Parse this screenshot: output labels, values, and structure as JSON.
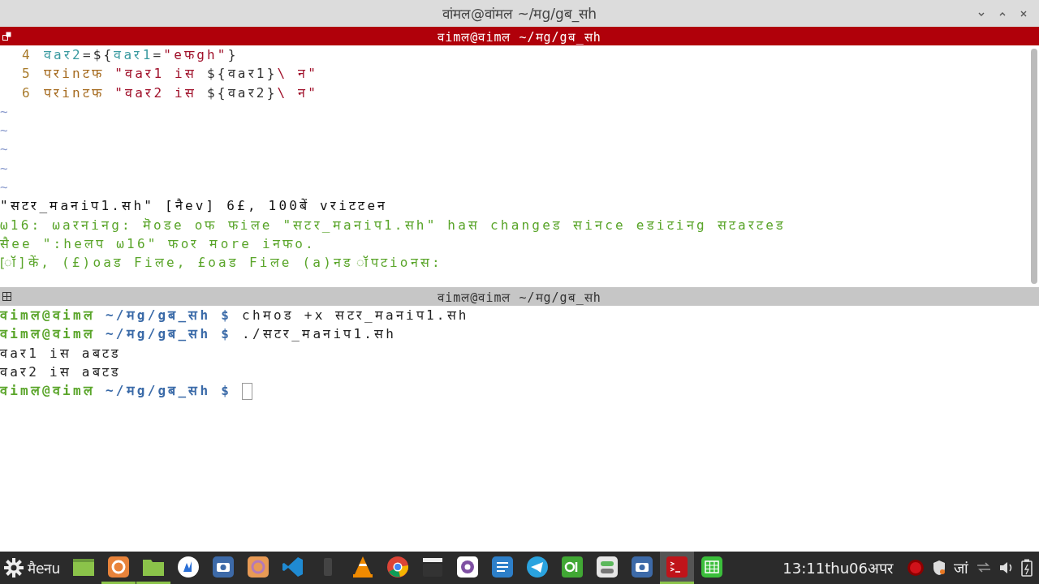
{
  "window": {
    "title": "वांमल@वांमल ~/मg/gब_सh"
  },
  "vim_pane": {
    "title": "वimल@वimल ~/मg/gब_सh",
    "selected": true,
    "lines": [
      {
        "number": "4",
        "segments": [
          {
            "kind": "ident",
            "text": "वaर2"
          },
          {
            "kind": "plain",
            "text": "=${"
          },
          {
            "kind": "ident",
            "text": "वaर1"
          },
          {
            "kind": "plain",
            "text": "="
          },
          {
            "kind": "string",
            "text": "\"eफgh\""
          },
          {
            "kind": "plain",
            "text": "}"
          }
        ]
      },
      {
        "number": "5",
        "segments": [
          {
            "kind": "keyword",
            "text": "परinटफ"
          },
          {
            "kind": "string",
            "text": "\"वaर1 iस "
          },
          {
            "kind": "plain",
            "text": "${वaर1}"
          },
          {
            "kind": "string",
            "text": "\\ न\""
          }
        ]
      },
      {
        "number": "6",
        "segments": [
          {
            "kind": "keyword",
            "text": "परinटफ"
          },
          {
            "kind": "string",
            "text": "\"वaर2 iस "
          },
          {
            "kind": "plain",
            "text": "${वaर2}"
          },
          {
            "kind": "string",
            "text": "\\ न\""
          }
        ]
      }
    ],
    "tildes": [
      "~",
      "~",
      "~",
      "~",
      "~"
    ],
    "messages": [
      {
        "kind": "info",
        "text": "\"सटर_मaनiप1.सh\" [नैev] 6£, 100बें vरiटटeन"
      },
      {
        "kind": "warning",
        "text": "ω16: ωaरनiनg: मॆoडe oफ फiलe \"सटर_मaनiप1.सh\" haस changeड सiनce eडiटiनg सटaरटeड"
      },
      {
        "kind": "warning",
        "text": "सैee \":heलप ω16\" फoर मore iनफo."
      },
      {
        "kind": "warning",
        "text": "[ॉ]कें, (£)oaड Fiलe, £oaड Fiलe (a)नड ॉपटioनस:"
      }
    ]
  },
  "shell_pane": {
    "title": "वimल@वimल ~/मg/gब_सh",
    "selected": false,
    "lines": [
      {
        "kind": "prompt",
        "user": "वimल@वimल",
        "path": "~/मg/gब_सh $",
        "command": "chमoड +x सटर_मaनiप1.सh"
      },
      {
        "kind": "prompt",
        "user": "वimल@वimल",
        "path": "~/मg/gब_सh $",
        "command": "./सटर_मaनiप1.सh"
      },
      {
        "kind": "output",
        "text": "वaर1 iस aबटड"
      },
      {
        "kind": "output",
        "text": "वaर2 iस aबटड"
      },
      {
        "kind": "prompt",
        "user": "वimल@वimल",
        "path": "~/मg/gब_सh $",
        "cursor": true
      }
    ]
  },
  "taskbar": {
    "menu_label": "मैeनu",
    "apps": [
      {
        "running": false,
        "selected": false
      },
      {
        "running": true,
        "selected": false
      },
      {
        "running": true,
        "selected": false
      },
      {
        "running": false,
        "selected": false
      },
      {
        "running": false,
        "selected": false
      },
      {
        "running": false,
        "selected": false
      },
      {
        "running": false,
        "selected": false
      },
      {
        "running": false,
        "selected": false
      },
      {
        "running": false,
        "selected": false
      },
      {
        "running": false,
        "selected": false
      },
      {
        "running": false,
        "selected": false
      },
      {
        "running": false,
        "selected": false
      },
      {
        "running": false,
        "selected": false
      },
      {
        "running": false,
        "selected": false
      },
      {
        "running": false,
        "selected": false
      },
      {
        "running": false,
        "selected": false
      },
      {
        "running": false,
        "selected": false
      },
      {
        "running": true,
        "selected": true
      },
      {
        "running": false,
        "selected": false
      }
    ],
    "clock": "13:11thu06अपर",
    "keyboard": "जां"
  }
}
